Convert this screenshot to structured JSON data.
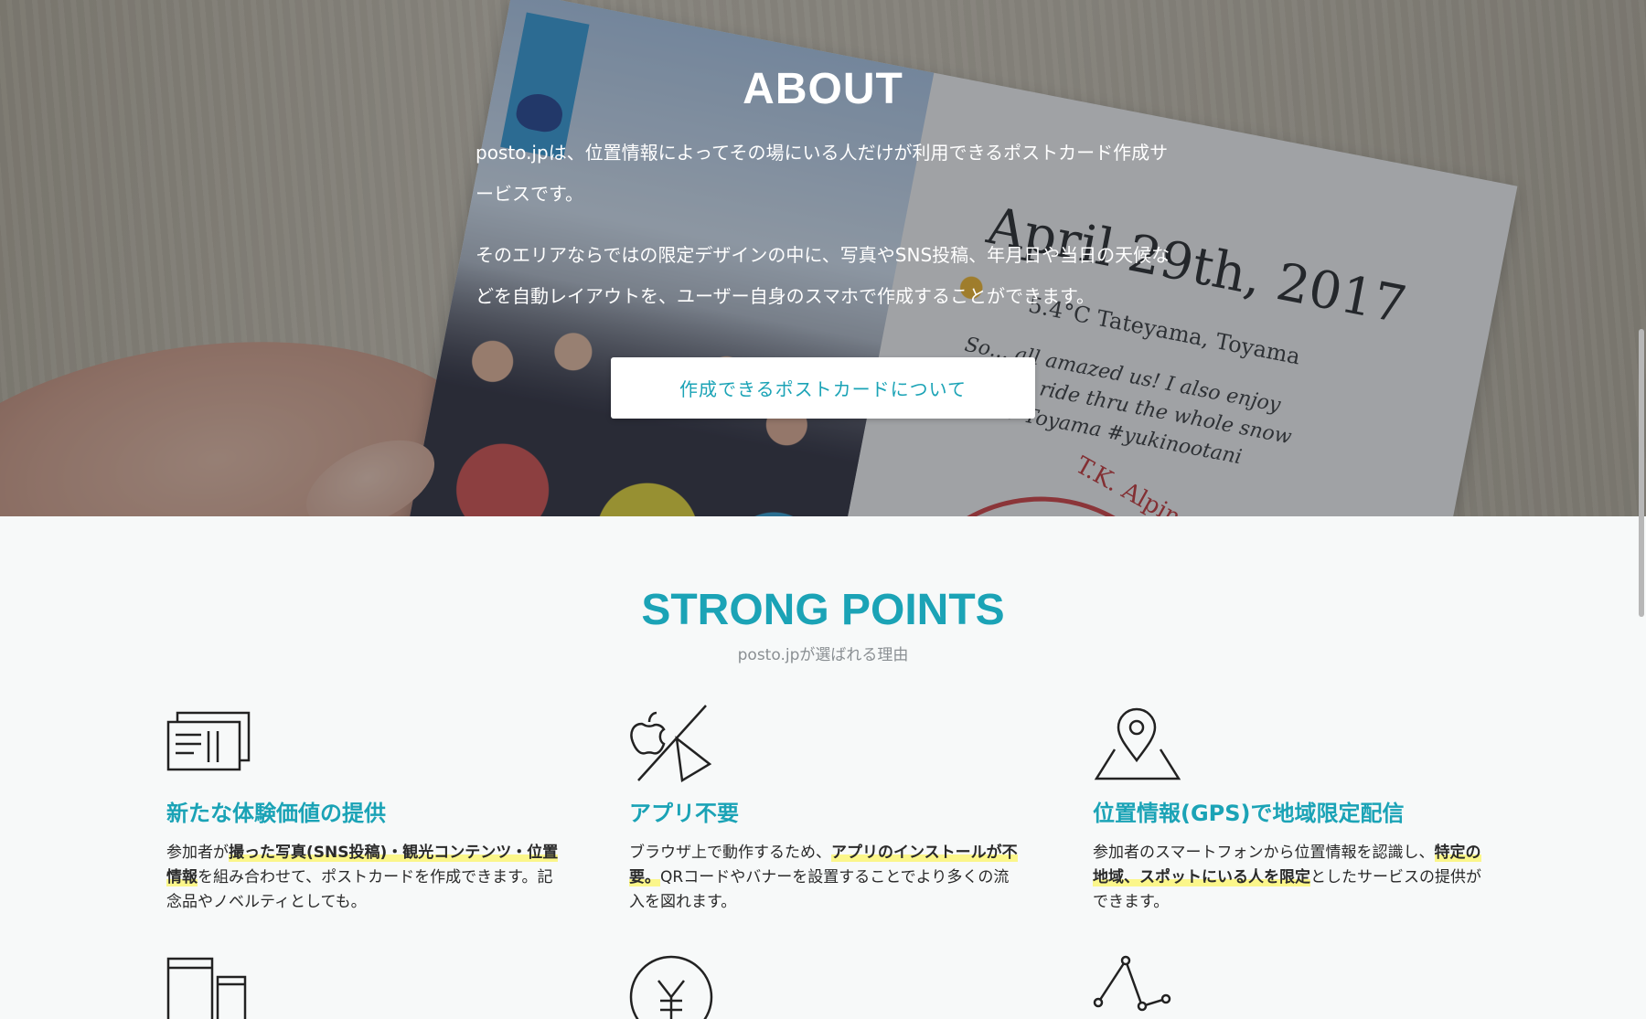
{
  "about": {
    "title": "ABOUT",
    "paragraph1": "posto.jpは、位置情報によってその場にいる人だけが利用できるポストカード作成サービスです。",
    "paragraph2": "そのエリアならではの限定デザインの中に、写真やSNS投稿、年月日や当日の天候などを自動レイアウトを、ユーザー自身のスマホで作成することができます。",
    "button_label": "作成できるポストカードについて"
  },
  "background_card": {
    "date": "April 29th, 2017",
    "meta": "5.4°C  Tateyama, Toyama",
    "lines": "So... all amazed us! I also enjoy the bus ride thru the whole snow wall # Toyama #yukinootani",
    "stamp": "T.K. Alpine Route"
  },
  "strong_points": {
    "title": "STRONG POINTS",
    "subtitle": "posto.jpが選ばれる理由",
    "features": [
      {
        "icon": "postcard-icon",
        "title": "新たな体験価値の提供",
        "desc": [
          {
            "t": "参加者が",
            "h": false
          },
          {
            "t": "撮った写真(SNS投稿)・観光コンテンツ・位置情報",
            "h": true
          },
          {
            "t": "を組み合わせて、ポストカードを作成できます。記念品やノベルティとしても。",
            "h": false
          }
        ]
      },
      {
        "icon": "no-app-icon",
        "title": "アプリ不要",
        "desc": [
          {
            "t": "ブラウザ上で動作するため、",
            "h": false
          },
          {
            "t": "アプリのインストールが不要。",
            "h": true
          },
          {
            "t": "QRコードやバナーを設置することでより多くの流入を図れます。",
            "h": false
          }
        ]
      },
      {
        "icon": "map-pin-icon",
        "title": "位置情報(GPS)で地域限定配信",
        "desc": [
          {
            "t": "参加者のスマートフォンから位置情報を認識し、",
            "h": false
          },
          {
            "t": "特定の地域、スポットにいる人を限定",
            "h": true
          },
          {
            "t": "としたサービスの提供ができます。",
            "h": false
          }
        ]
      }
    ],
    "next_icons": [
      "devices-icon",
      "yen-icon",
      "line-graph-icon"
    ]
  },
  "colors": {
    "accent": "#1ba3b6",
    "highlight": "#fbf68a",
    "section_bg": "#f7f9f9"
  }
}
